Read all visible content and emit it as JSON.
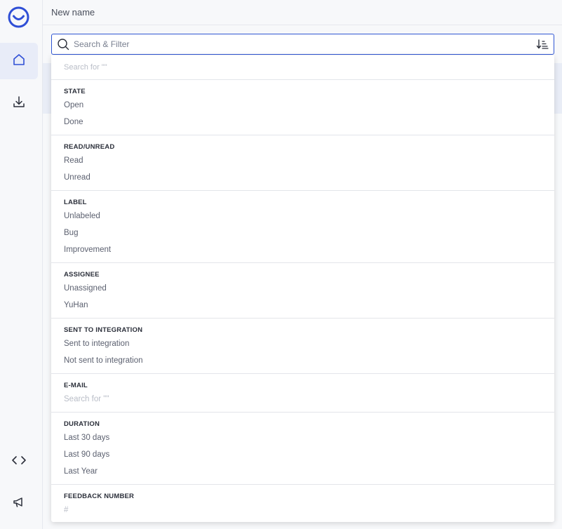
{
  "app": {
    "title": "New name"
  },
  "sidebar": {
    "items": [
      {
        "name": "home",
        "icon": "home-icon",
        "active": true
      },
      {
        "name": "download",
        "icon": "download-icon",
        "active": false
      },
      {
        "name": "code",
        "icon": "code-icon",
        "active": false
      },
      {
        "name": "announce",
        "icon": "megaphone-icon",
        "active": false
      }
    ]
  },
  "search": {
    "placeholder": "Search & Filter",
    "value": ""
  },
  "dropdown": {
    "search_hint": "Search for \"\"",
    "sections": [
      {
        "title": "STATE",
        "items": [
          "Open",
          "Done"
        ]
      },
      {
        "title": "READ/UNREAD",
        "items": [
          "Read",
          "Unread"
        ]
      },
      {
        "title": "LABEL",
        "items": [
          "Unlabeled",
          "Bug",
          "Improvement"
        ]
      },
      {
        "title": "ASSIGNEE",
        "items": [
          "Unassigned",
          "YuHan"
        ]
      },
      {
        "title": "SENT TO INTEGRATION",
        "items": [
          "Sent to integration",
          "Not sent to integration"
        ]
      },
      {
        "title": "E-MAIL",
        "placeholder": "Search for \"\""
      },
      {
        "title": "DURATION",
        "items": [
          "Last 30 days",
          "Last 90 days",
          "Last Year"
        ]
      },
      {
        "title": "FEEDBACK NUMBER",
        "placeholder": "#"
      }
    ]
  },
  "colors": {
    "accent": "#3056d3",
    "sidebar_bg": "#f7f8fa"
  }
}
